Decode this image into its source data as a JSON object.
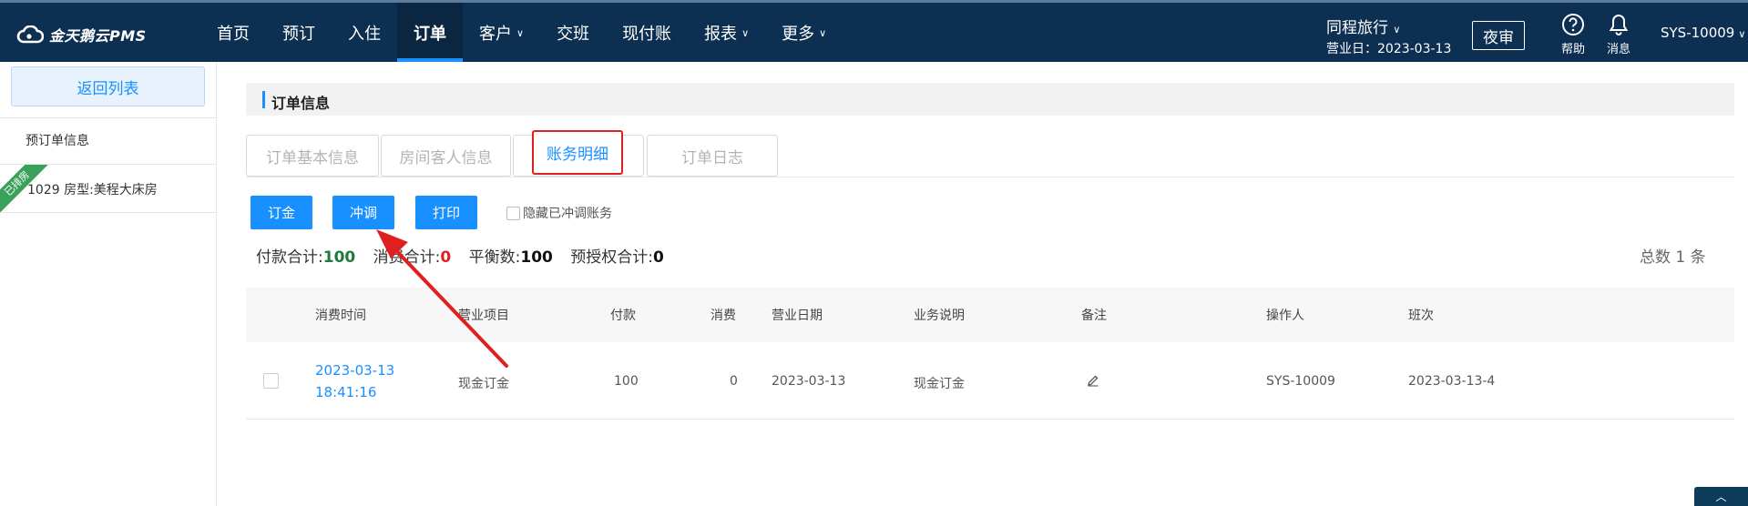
{
  "brand": {
    "name": "金天鹅云PMS"
  },
  "nav": {
    "items": [
      {
        "label": "首页",
        "chev": ""
      },
      {
        "label": "预订",
        "chev": ""
      },
      {
        "label": "入住",
        "chev": ""
      },
      {
        "label": "订单",
        "chev": ""
      },
      {
        "label": "客户",
        "chev": "∨"
      },
      {
        "label": "交班",
        "chev": ""
      },
      {
        "label": "现付账",
        "chev": ""
      },
      {
        "label": "报表",
        "chev": "∨"
      },
      {
        "label": "更多",
        "chev": "∨"
      }
    ],
    "active_index": 3
  },
  "header": {
    "hotel": "同程旅行",
    "hotel_chev": "∨",
    "business_date_label": "营业日：",
    "business_date": "2023-03-13",
    "night_audit": "夜审",
    "help": "帮助",
    "messages": "消息",
    "user": "SYS-10009",
    "user_chev": "∨"
  },
  "sidebar": {
    "back": "返回列表",
    "section_label": "预订单信息",
    "ribbon": "已排房",
    "room_text": "1029  房型:美程大床房"
  },
  "section": {
    "title": "订单信息"
  },
  "tabs": [
    "订单基本信息",
    "房间客人信息",
    "账务明细",
    "订单日志"
  ],
  "actions": {
    "deposit": "订金",
    "reverse": "冲调",
    "print": "打印",
    "hide_reversed": "隐藏已冲调账务"
  },
  "summary": {
    "payment_label": "付款合计:",
    "payment_value": "100",
    "consume_label": "消费合计:",
    "consume_value": "0",
    "balance_label": "平衡数:",
    "balance_value": "100",
    "preauth_label": "预授权合计:",
    "preauth_value": "0",
    "total_text": "总数 1 条"
  },
  "table": {
    "columns": [
      "消费时间",
      "营业项目",
      "付款",
      "消费",
      "营业日期",
      "业务说明",
      "备注",
      "操作人",
      "班次"
    ],
    "rows": [
      {
        "time_date": "2023-03-13",
        "time_clock": "18:41:16",
        "item": "现金订金",
        "payment": "100",
        "consume": "0",
        "biz_date": "2023-03-13",
        "description": "现金订金",
        "operator": "SYS-10009",
        "shift": "2023-03-13-4"
      }
    ]
  },
  "colors": {
    "nav_bg": "#0d2f52",
    "accent": "#1890ff",
    "highlight_red": "#e02020",
    "payment_green": "#1e7b3a"
  },
  "icons": [
    "cloud-logo-icon",
    "help-icon",
    "bell-icon",
    "pencil-edit-icon",
    "annotation-arrow"
  ]
}
